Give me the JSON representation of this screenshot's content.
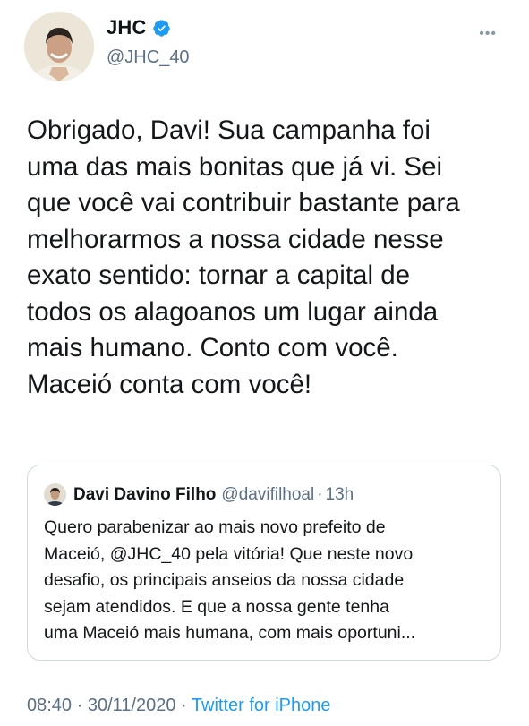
{
  "author": {
    "display_name": "JHC",
    "handle": "@JHC_40",
    "verified": true
  },
  "tweet": {
    "lines": [
      "Obrigado, Davi! Sua campanha foi",
      "uma das mais bonitas que já vi. Sei",
      "que você vai contribuir bastante para",
      "melhorarmos a nossa cidade nesse",
      "exato sentido: tornar a capital de",
      "todos os alagoanos um lugar ainda",
      "mais humano. Conto com você.",
      "Maceió conta com você!"
    ]
  },
  "quoted_tweet": {
    "display_name": "Davi Davino Filho",
    "handle": "@davifilhoal",
    "separator": "·",
    "time": "13h",
    "lines": [
      "Quero parabenizar ao mais novo prefeito de",
      "Maceió, @JHC_40 pela vitória! Que neste novo",
      "desafio, os principais anseios da nossa cidade",
      "sejam atendidos. E que a nossa gente tenha",
      "uma Maceió mais humana, com mais oportuni..."
    ]
  },
  "meta": {
    "time": "08:40",
    "separator": " · ",
    "date": "30/11/2020",
    "source": "Twitter for iPhone"
  },
  "icons": {
    "verified": "verified-badge-icon",
    "more": "more-options-icon"
  },
  "colors": {
    "link": "#1d9bf0",
    "secondary_text": "#5b7083",
    "verified": "#1d9bf0"
  }
}
